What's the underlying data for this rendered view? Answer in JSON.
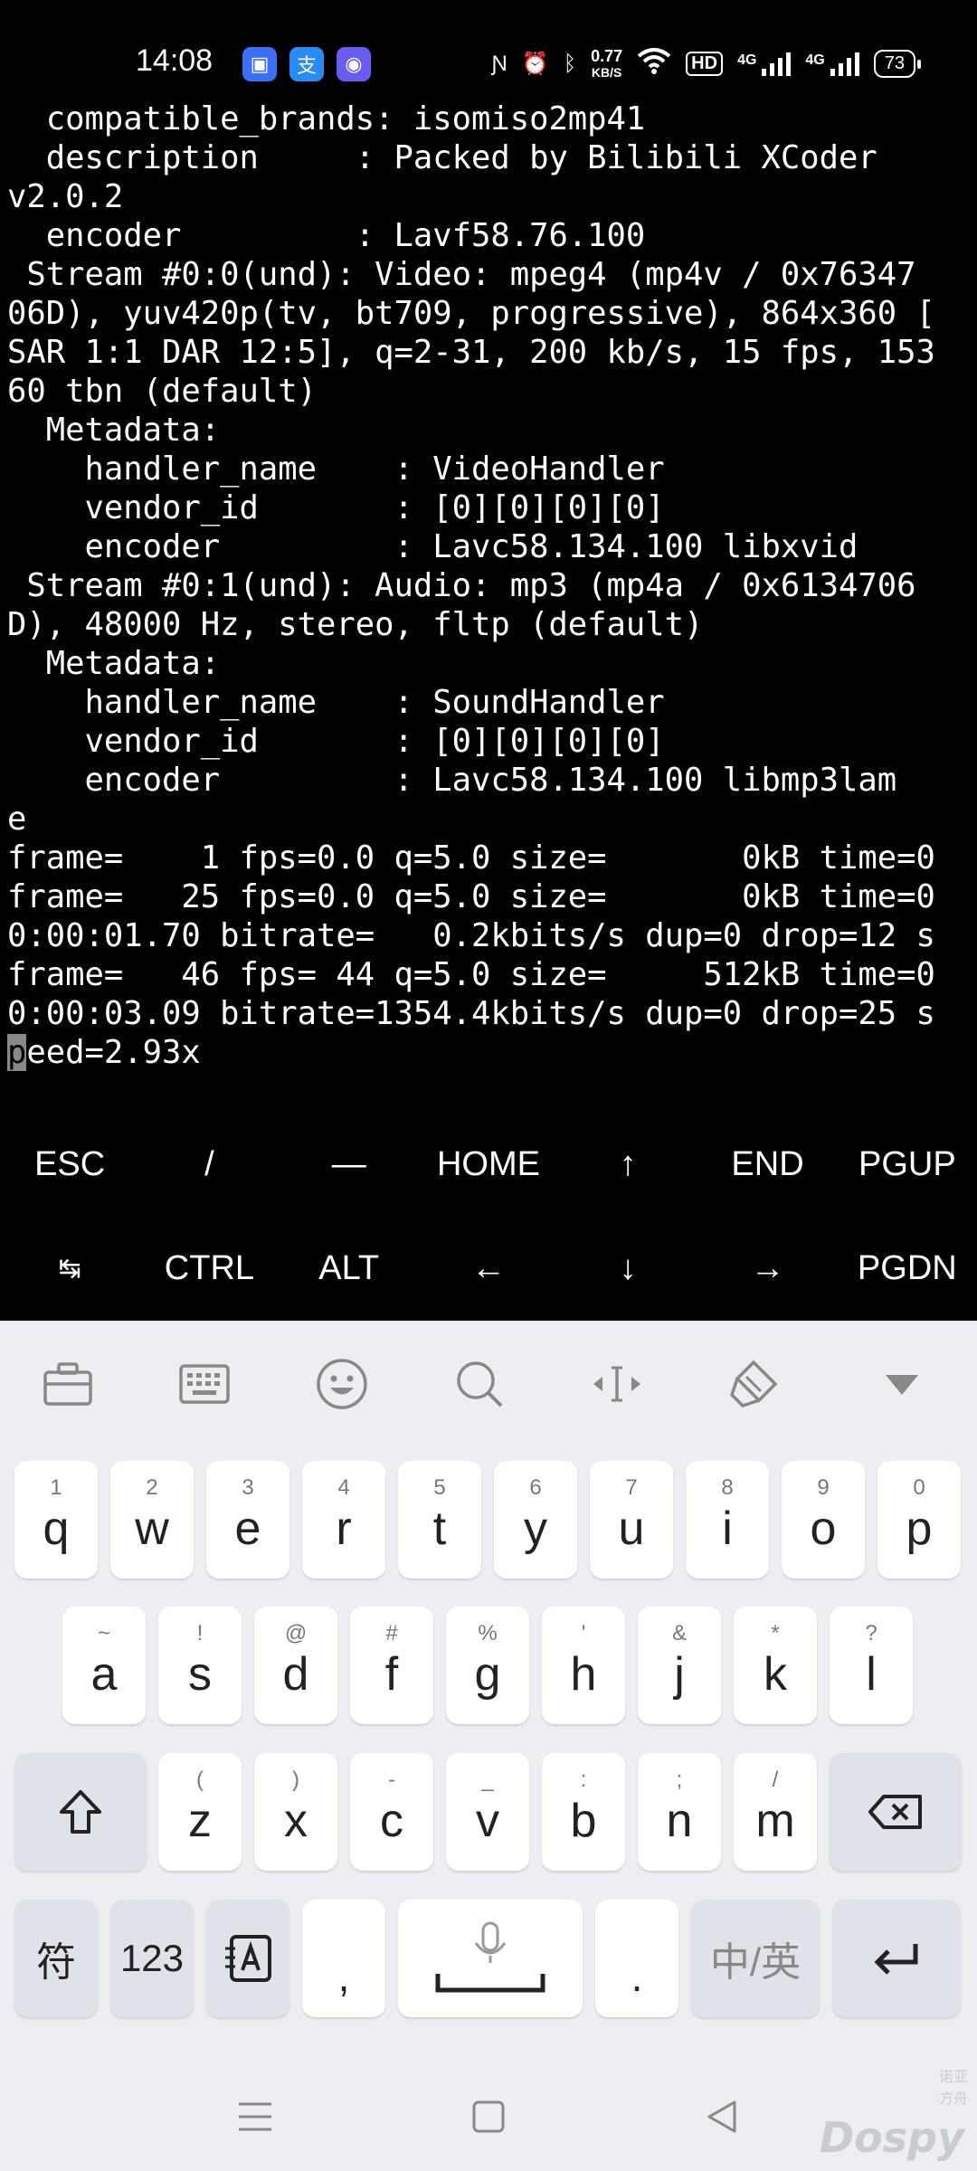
{
  "status_bar": {
    "time": "14:08",
    "net_speed_value": "0.77",
    "net_speed_unit": "KB/S",
    "hd_label": "HD",
    "signal1": "4G",
    "signal2": "4G",
    "battery": "73"
  },
  "terminal": {
    "lines": [
      "  compatible_brands: isomiso2mp41",
      "  description     : Packed by Bilibili XCoder",
      "v2.0.2",
      "  encoder         : Lavf58.76.100",
      " Stream #0:0(und): Video: mpeg4 (mp4v / 0x76347",
      "06D), yuv420p(tv, bt709, progressive), 864x360 [",
      "SAR 1:1 DAR 12:5], q=2-31, 200 kb/s, 15 fps, 153",
      "60 tbn (default)",
      "  Metadata:",
      "    handler_name    : VideoHandler",
      "    vendor_id       : [0][0][0][0]",
      "    encoder         : Lavc58.134.100 libxvid",
      " Stream #0:1(und): Audio: mp3 (mp4a / 0x6134706",
      "D), 48000 Hz, stereo, fltp (default)",
      "  Metadata:",
      "    handler_name    : SoundHandler",
      "    vendor_id       : [0][0][0][0]",
      "    encoder         : Lavc58.134.100 libmp3lam",
      "e",
      "frame=    1 fps=0.0 q=5.0 size=       0kB time=0",
      "frame=   25 fps=0.0 q=5.0 size=       0kB time=0",
      "0:00:01.70 bitrate=   0.2kbits/s dup=0 drop=12 s",
      "frame=   46 fps= 44 q=5.0 size=     512kB time=0",
      "0:00:03.09 bitrate=1354.4kbits/s dup=0 drop=25 s"
    ],
    "last_line_cursor_char": "p",
    "last_line_rest": "eed=2.93x"
  },
  "extra_keys": {
    "row1": [
      "ESC",
      "/",
      "—",
      "HOME",
      "↑",
      "END",
      "PGUP"
    ],
    "row2": [
      "↹",
      "CTRL",
      "ALT",
      "←",
      "↓",
      "→",
      "PGDN"
    ]
  },
  "keyboard": {
    "row1": [
      {
        "main": "q",
        "sub": "1"
      },
      {
        "main": "w",
        "sub": "2"
      },
      {
        "main": "e",
        "sub": "3"
      },
      {
        "main": "r",
        "sub": "4"
      },
      {
        "main": "t",
        "sub": "5"
      },
      {
        "main": "y",
        "sub": "6"
      },
      {
        "main": "u",
        "sub": "7"
      },
      {
        "main": "i",
        "sub": "8"
      },
      {
        "main": "o",
        "sub": "9"
      },
      {
        "main": "p",
        "sub": "0"
      }
    ],
    "row2": [
      {
        "main": "a",
        "sub": "~"
      },
      {
        "main": "s",
        "sub": "!"
      },
      {
        "main": "d",
        "sub": "@"
      },
      {
        "main": "f",
        "sub": "#"
      },
      {
        "main": "g",
        "sub": "%"
      },
      {
        "main": "h",
        "sub": "'"
      },
      {
        "main": "j",
        "sub": "&"
      },
      {
        "main": "k",
        "sub": "*"
      },
      {
        "main": "l",
        "sub": "?"
      }
    ],
    "row3": [
      {
        "main": "z",
        "sub": "("
      },
      {
        "main": "x",
        "sub": ")"
      },
      {
        "main": "c",
        "sub": "-"
      },
      {
        "main": "v",
        "sub": "_"
      },
      {
        "main": "b",
        "sub": ":"
      },
      {
        "main": "n",
        "sub": ";"
      },
      {
        "main": "m",
        "sub": "/"
      }
    ],
    "symbols_label": "符",
    "numbers_label": "123",
    "comma_label": ",",
    "period_label": ".",
    "lang_label": "中/英"
  },
  "watermark": {
    "text": "Dospy",
    "sub": "诺亚方舟"
  },
  "colors": {
    "terminal_bg": "#000000",
    "terminal_fg": "#ffffff",
    "keyboard_bg": "#eceef2",
    "key_bg": "#ffffff",
    "key_dark_bg": "#dfe2e8"
  }
}
